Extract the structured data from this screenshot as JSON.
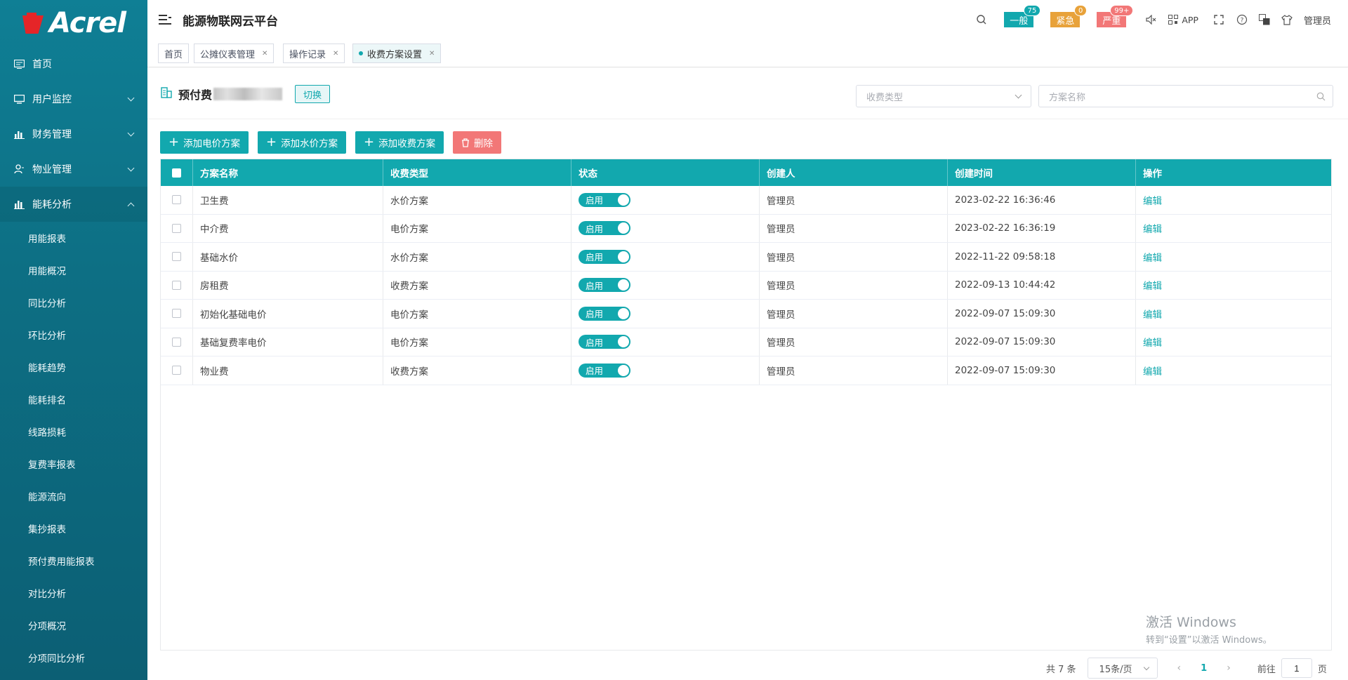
{
  "brand": {
    "logo_text": "Acrel"
  },
  "sidebar": {
    "items": [
      {
        "label": "首页",
        "icon": "dashboard-icon"
      },
      {
        "label": "用户监控",
        "icon": "monitor-icon"
      },
      {
        "label": "财务管理",
        "icon": "finance-icon"
      },
      {
        "label": "物业管理",
        "icon": "user-icon"
      },
      {
        "label": "能耗分析",
        "icon": "chart-icon"
      }
    ],
    "subitems": [
      "用能报表",
      "用能概况",
      "同比分析",
      "环比分析",
      "能耗趋势",
      "能耗排名",
      "线路损耗",
      "复费率报表",
      "能源流向",
      "集抄报表",
      "预付费用能报表",
      "对比分析",
      "分项概况",
      "分项同比分析"
    ]
  },
  "header": {
    "title": "能源物联网云平台",
    "alarms": [
      {
        "label": "一般",
        "count": "75",
        "color": "#12a8ae"
      },
      {
        "label": "紧急",
        "count": "0",
        "color": "#e8a23a"
      },
      {
        "label": "严重",
        "count": "99+",
        "color": "#f27777"
      }
    ],
    "app_label": "APP",
    "user": "管理员"
  },
  "tabs": [
    {
      "label": "首页"
    },
    {
      "label": "公摊仪表管理"
    },
    {
      "label": "操作记录"
    },
    {
      "label": "收费方案设置"
    }
  ],
  "project": {
    "name": "预付费",
    "switch_label": "切换"
  },
  "filters": {
    "type_placeholder": "收费类型",
    "name_placeholder": "方案名称"
  },
  "actions": {
    "add_elec": "添加电价方案",
    "add_water": "添加水价方案",
    "add_fee": "添加收费方案",
    "delete": "删除"
  },
  "table": {
    "headers": [
      "方案名称",
      "收费类型",
      "状态",
      "创建人",
      "创建时间",
      "操作"
    ],
    "rows": [
      {
        "name": "卫生费",
        "type": "水价方案",
        "status": "启用",
        "creator": "管理员",
        "time": "2023-02-22 16:36:46",
        "action": "编辑"
      },
      {
        "name": "中介费",
        "type": "电价方案",
        "status": "启用",
        "creator": "管理员",
        "time": "2023-02-22 16:36:19",
        "action": "编辑"
      },
      {
        "name": "基础水价",
        "type": "水价方案",
        "status": "启用",
        "creator": "管理员",
        "time": "2022-11-22 09:58:18",
        "action": "编辑"
      },
      {
        "name": "房租费",
        "type": "收费方案",
        "status": "启用",
        "creator": "管理员",
        "time": "2022-09-13 10:44:42",
        "action": "编辑"
      },
      {
        "name": "初始化基础电价",
        "type": "电价方案",
        "status": "启用",
        "creator": "管理员",
        "time": "2022-09-07 15:09:30",
        "action": "编辑"
      },
      {
        "name": "基础复费率电价",
        "type": "电价方案",
        "status": "启用",
        "creator": "管理员",
        "time": "2022-09-07 15:09:30",
        "action": "编辑"
      },
      {
        "name": "物业费",
        "type": "收费方案",
        "status": "启用",
        "creator": "管理员",
        "time": "2022-09-07 15:09:30",
        "action": "编辑"
      }
    ]
  },
  "pagination": {
    "total": "共 7 条",
    "page_size": "15条/页",
    "current": "1",
    "goto_prefix": "前往",
    "goto_value": "1",
    "goto_suffix": "页"
  },
  "watermark": {
    "line1": "激活 Windows",
    "line2": "转到“设置”以激活 Windows。"
  },
  "colors": {
    "accent": "#12a8ae",
    "danger": "#f27777",
    "sidebar": "#0f7f95"
  }
}
